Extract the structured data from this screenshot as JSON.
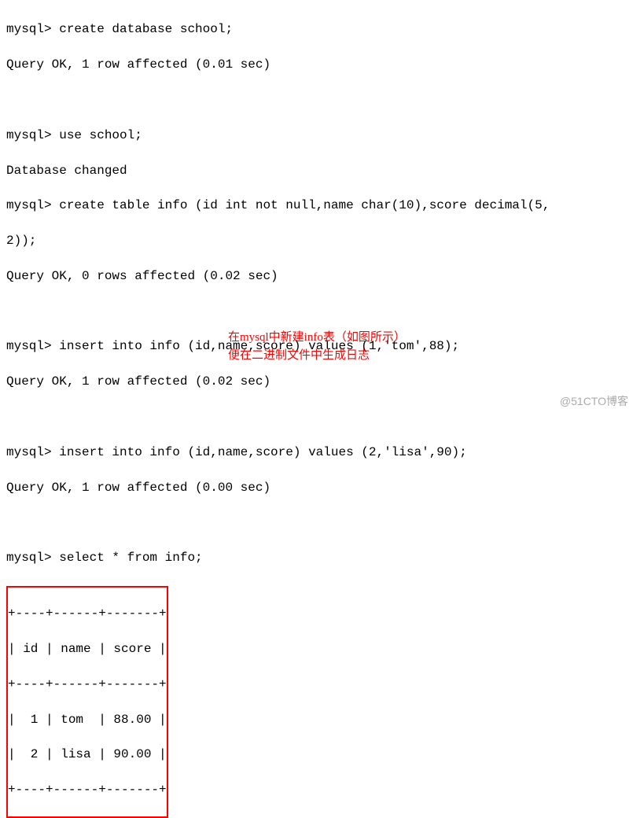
{
  "terminal": {
    "line1": "mysql> create database school;",
    "line2": "Query OK, 1 row affected (0.01 sec)",
    "line3": "",
    "line4": "mysql> use school;",
    "line5": "Database changed",
    "line6": "mysql> create table info (id int not null,name char(10),score decimal(5,",
    "line7": "2));",
    "line8": "Query OK, 0 rows affected (0.02 sec)",
    "line9": "",
    "line10": "mysql> insert into info (id,name,score) values (1,'tom',88);",
    "line11": "Query OK, 1 row affected (0.02 sec)",
    "line12": "",
    "line13": "mysql> insert into info (id,name,score) values (2,'lisa',90);",
    "line14": "Query OK, 1 row affected (0.00 sec)",
    "line15": "",
    "line16": "mysql> select * from info;"
  },
  "table": {
    "border_top": "+----+------+-------+",
    "header": "| id | name | score |",
    "border_mid": "+----+------+-------+",
    "row1": "|  1 | tom  | 88.00 |",
    "row2": "|  2 | lisa | 90.00 |",
    "border_bot": "+----+------+-------+"
  },
  "chart_data": {
    "type": "table",
    "columns": [
      "id",
      "name",
      "score"
    ],
    "rows": [
      {
        "id": 1,
        "name": "tom",
        "score": 88.0
      },
      {
        "id": 2,
        "name": "lisa",
        "score": 90.0
      }
    ]
  },
  "annotation": {
    "line1": "在mysql中新建info表（如图所示）",
    "line2": "便在二进制文件中生成日志"
  },
  "watermark": "@51CTO博客"
}
